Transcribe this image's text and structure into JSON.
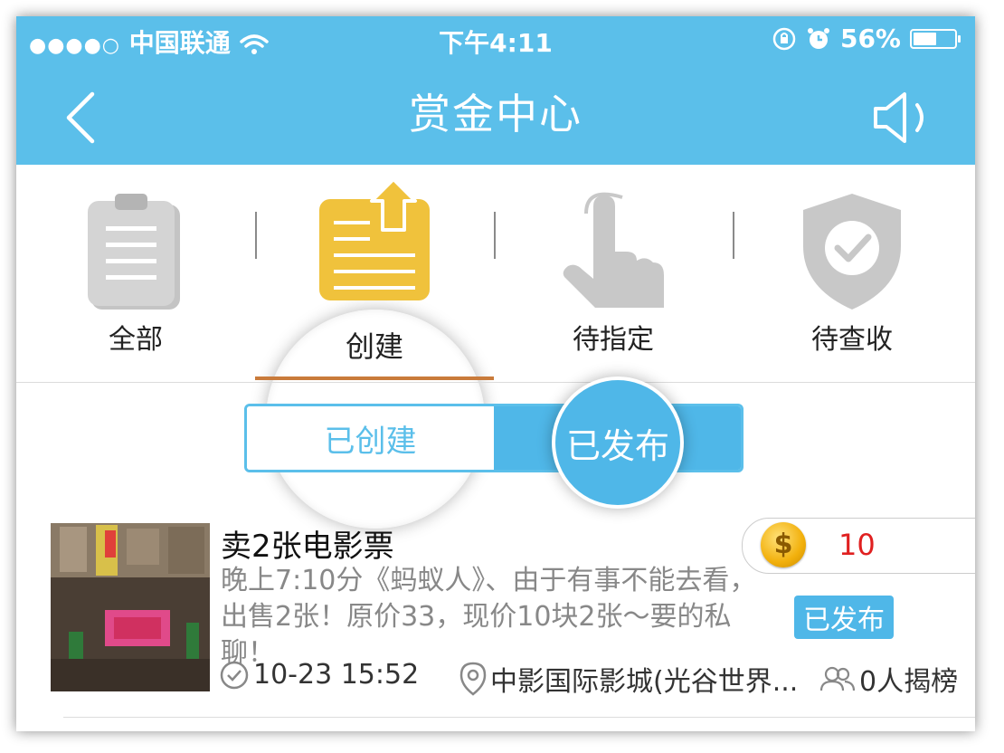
{
  "status_bar": {
    "signal": "●●●●○",
    "carrier": "中国联通",
    "time": "下午4:11",
    "battery": "56%",
    "battery_level": 0.56
  },
  "header": {
    "title": "赏金中心",
    "icons": {
      "back": "chevron-left-icon",
      "speaker": "speaker-icon"
    }
  },
  "tabs": [
    {
      "label": "全部",
      "icon": "clipboard-icon",
      "active": false
    },
    {
      "label": "创建",
      "icon": "create-document-icon",
      "active": true
    },
    {
      "label": "待指定",
      "icon": "pointing-hand-icon",
      "active": false
    },
    {
      "label": "待查收",
      "icon": "shield-check-icon",
      "active": false
    }
  ],
  "segment": {
    "option1": "已创建",
    "option2": "已发布",
    "selected": "option2"
  },
  "items": [
    {
      "title": "卖2张电影票",
      "description": "晚上7:10分《蚂蚁人》、由于有事不能去看，出售2张！原价33，现价10块2张～要的私聊！",
      "reward": "10",
      "status": "已发布",
      "time": "10-23 15:52",
      "location": "中影国际影城(光谷世界...",
      "participants": "0人揭榜"
    }
  ],
  "colors": {
    "header_bg": "#5bbfea",
    "active_tab_icon": "#f0c23c",
    "inactive_icon": "#c8c8c8",
    "tab_underline": "#c97b3b",
    "reward_text": "#e02020"
  }
}
